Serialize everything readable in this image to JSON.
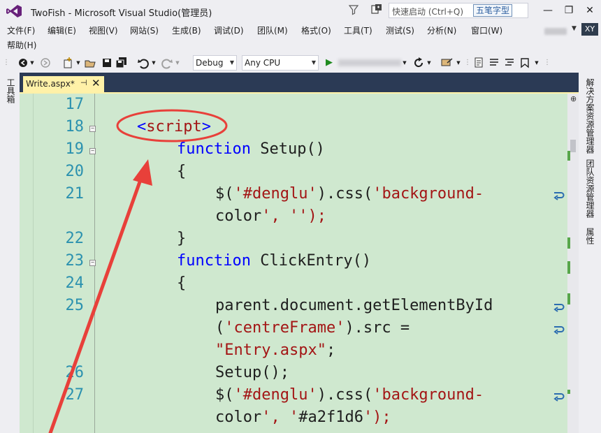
{
  "window": {
    "title": "TwoFish - Microsoft Visual Studio(管理员)",
    "quick_launch_placeholder": "快速启动 (Ctrl+Q)",
    "ime_label": "五笔字型",
    "minimize": "—",
    "restore": "❐",
    "close": "✕"
  },
  "menu": {
    "items": [
      "文件(F)",
      "编辑(E)",
      "视图(V)",
      "网站(S)",
      "生成(B)",
      "调试(D)",
      "团队(M)",
      "格式(O)",
      "工具(T)",
      "测试(S)",
      "分析(N)",
      "窗口(W)"
    ],
    "help": "帮助(H)",
    "account_initials": "XY"
  },
  "toolbar": {
    "config": "Debug",
    "platform": "Any CPU",
    "start_glyph": "▶"
  },
  "side_panels": {
    "left": "工具箱",
    "right": [
      "解决方案资源管理器",
      "团队资源管理器",
      "属性"
    ]
  },
  "editor": {
    "tab_label": "Write.aspx*",
    "pin_glyph": "⊣",
    "close_glyph": "✕",
    "lines": [
      {
        "num": "17",
        "text": ""
      },
      {
        "num": "18",
        "text": "<script>"
      },
      {
        "num": "19",
        "text": "function Setup()"
      },
      {
        "num": "20",
        "text": "{"
      },
      {
        "num": "21",
        "text": "$('#denglu').css('background-"
      },
      {
        "num": "",
        "text": "color', '');"
      },
      {
        "num": "22",
        "text": "}"
      },
      {
        "num": "23",
        "text": "function ClickEntry()"
      },
      {
        "num": "24",
        "text": "{"
      },
      {
        "num": "25",
        "text": "parent.document.getElementById"
      },
      {
        "num": "",
        "text": "('centreFrame').src ="
      },
      {
        "num": "",
        "text": "\"Entry.aspx\";"
      },
      {
        "num": "26",
        "text": "Setup();"
      },
      {
        "num": "27",
        "text": "$('#denglu').css('background-"
      },
      {
        "num": "",
        "text": "color', '#a2f1d6');"
      }
    ]
  },
  "colors": {
    "editor_bg": "#cfe8cf",
    "keyword": "#0000ff",
    "string": "#a31515",
    "line_number": "#2b91af",
    "annotation": "#e8403a",
    "tab_active": "#fff1a8",
    "frame": "#2b3a55"
  }
}
